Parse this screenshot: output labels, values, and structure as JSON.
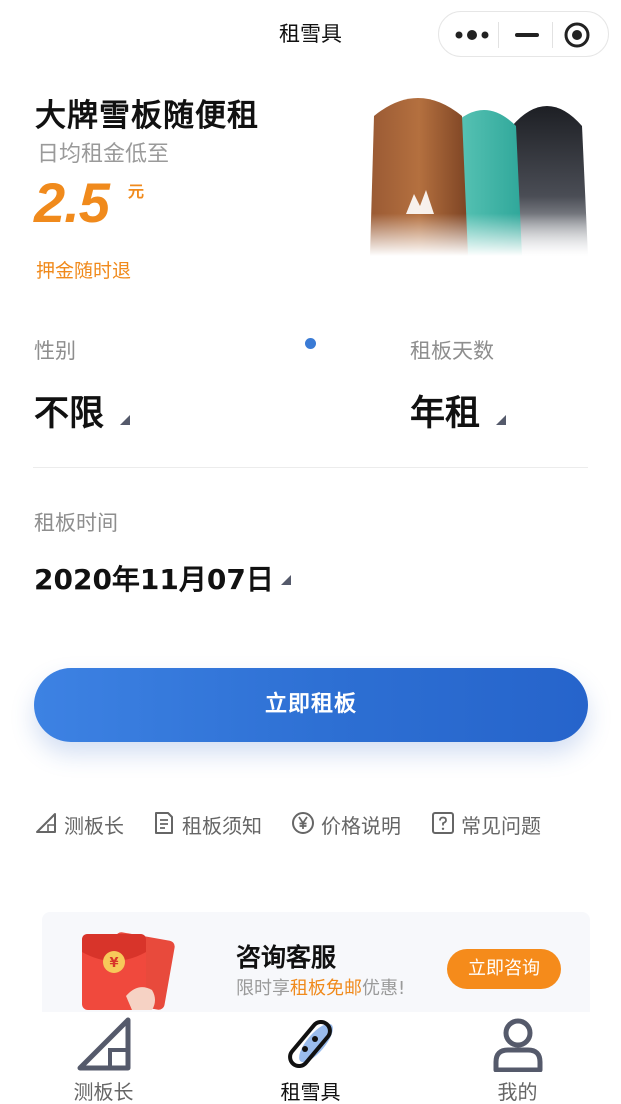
{
  "titlebar": {
    "title": "租雪具"
  },
  "banner": {
    "title": "大牌雪板随便租",
    "subtitle": "日均租金低至",
    "price": "2.5",
    "price_unit": "元",
    "deposit_note": "押金随时退"
  },
  "form": {
    "gender": {
      "label": "性别",
      "value": "不限"
    },
    "days": {
      "label": "租板天数",
      "value": "年租"
    },
    "time": {
      "label": "租板时间",
      "value": "2020年11月07日"
    },
    "submit_label": "立即租板"
  },
  "links": [
    {
      "label": "测板长",
      "icon": "ruler-triangle-icon"
    },
    {
      "label": "租板须知",
      "icon": "document-icon"
    },
    {
      "label": "价格说明",
      "icon": "yen-circle-icon"
    },
    {
      "label": "常见问题",
      "icon": "question-icon"
    }
  ],
  "service": {
    "title": "咨询客服",
    "sub_prefix": "限时享",
    "sub_highlight": "租板免邮",
    "sub_suffix": "优惠!",
    "button_label": "立即咨询"
  },
  "tabbar": [
    {
      "label": "测板长",
      "icon": "ruler-triangle-icon",
      "active": false
    },
    {
      "label": "租雪具",
      "icon": "snowboard-icon",
      "active": true
    },
    {
      "label": "我的",
      "icon": "user-icon",
      "active": false
    }
  ],
  "colors": {
    "accent": "#3a7bd5",
    "orange": "#f08a1c",
    "muted": "#8e8e8e"
  }
}
